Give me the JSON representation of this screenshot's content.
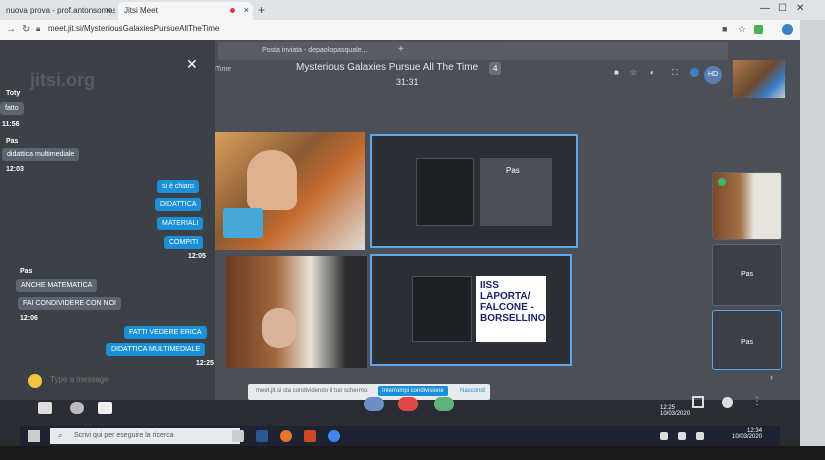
{
  "browser": {
    "tabs": [
      {
        "label": "nuova prova - prof.antonsomasi..."
      },
      {
        "label": "Jitsi Meet"
      }
    ],
    "url": "meet.jit.si/MysteriousGalaxiesPursueAllTheTime"
  },
  "inner_browser": {
    "tab_label": "Posta inviata - depaolopasquale...",
    "title_fragment": "eTime"
  },
  "meeting": {
    "title": "Mysterious Galaxies Pursue All The Time",
    "timer": "31:31",
    "participant_count": "4",
    "avatar_initials": "HD"
  },
  "chat": {
    "messages": [
      {
        "sender": "Toty",
        "text": "fatto",
        "time": "11:56",
        "dir": "in"
      },
      {
        "sender": "Pas",
        "text": "didattica multimediale",
        "time": "12:03",
        "dir": "in"
      },
      {
        "text": "si è chiaro",
        "dir": "out"
      },
      {
        "text": "DIDATTICA",
        "dir": "out"
      },
      {
        "text": "MATERIALI",
        "dir": "out"
      },
      {
        "text": "COMPITI",
        "time": "12:05",
        "dir": "out"
      },
      {
        "sender": "Pas",
        "text": "ANCHE MATEMATICA",
        "dir": "in"
      },
      {
        "text": "FAI CONDIVIDERE CON NOI",
        "time": "12:06",
        "dir": "in"
      },
      {
        "text": "FATTI VEDERE ERICA",
        "dir": "out"
      },
      {
        "text": "DIDATTICA MULTIMEDIALE",
        "time": "12:25",
        "dir": "out"
      }
    ],
    "input_placeholder": "Type a message",
    "watermark": "jitsi.org"
  },
  "share": {
    "mini_label": "Pas",
    "poster_text": "IISS LAPORTA/ FALCONE - BORSELLINO",
    "notice_text": "meet.jit.si sta condividendo il tuo schermo.",
    "stop_label": "Interrompi condivisione",
    "hide_label": "Nascondi"
  },
  "filmstrip": {
    "labels": [
      "Pas",
      "Pas"
    ]
  },
  "taskbar": {
    "search_placeholder": "Scrivi qui per eseguire la ricerca",
    "time": "12:34",
    "date": "10/03/2020",
    "inner_time": "12:25",
    "inner_date": "10/03/2020"
  }
}
